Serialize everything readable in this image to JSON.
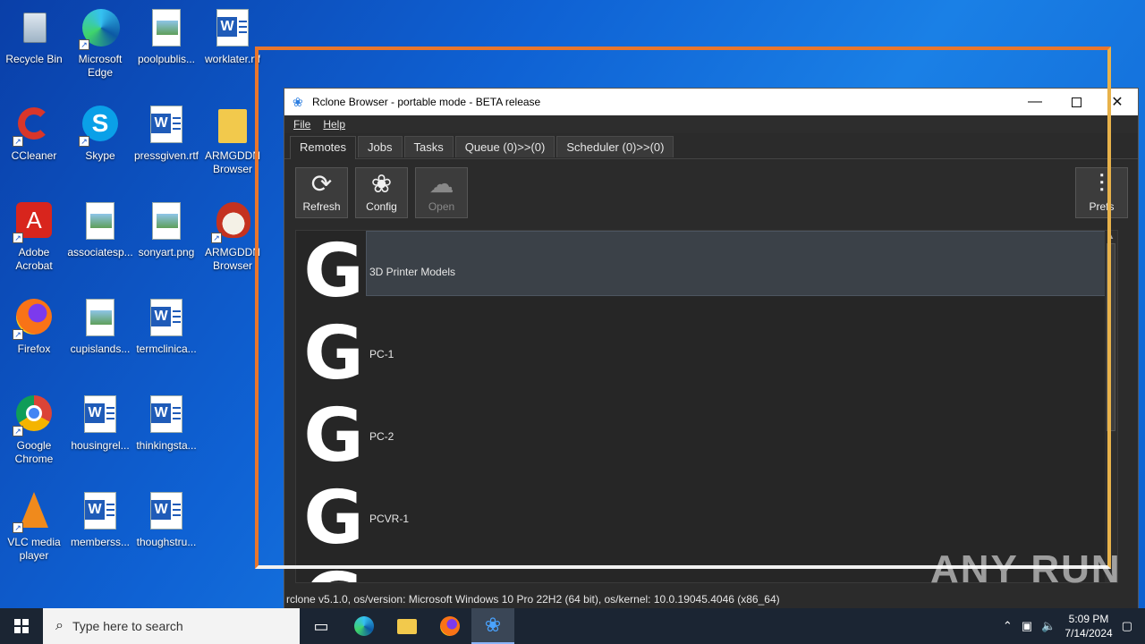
{
  "desktop_icons": [
    {
      "label": "Recycle Bin"
    },
    {
      "label": "Microsoft Edge"
    },
    {
      "label": "poolpublis..."
    },
    {
      "label": "worklater.rtf"
    },
    {
      "label": "CCleaner"
    },
    {
      "label": "Skype"
    },
    {
      "label": "pressgiven.rtf"
    },
    {
      "label": "ARMGDDN Browser"
    },
    {
      "label": "Adobe Acrobat"
    },
    {
      "label": "associatesp..."
    },
    {
      "label": "sonyart.png"
    },
    {
      "label": "ARMGDDN Browser"
    },
    {
      "label": "Firefox"
    },
    {
      "label": "cupislands..."
    },
    {
      "label": "termclinica..."
    },
    {
      "label": "Google Chrome"
    },
    {
      "label": "housingrel..."
    },
    {
      "label": "thinkingsta..."
    },
    {
      "label": "VLC media player"
    },
    {
      "label": "memberss..."
    },
    {
      "label": "thoughstru..."
    }
  ],
  "window": {
    "title": "Rclone Browser - portable mode - BETA release",
    "menu": {
      "file": "File",
      "help": "Help"
    },
    "tabs": [
      {
        "label": "Remotes"
      },
      {
        "label": "Jobs"
      },
      {
        "label": "Tasks"
      },
      {
        "label": "Queue (0)>>(0)"
      },
      {
        "label": "Scheduler (0)>>(0)"
      }
    ],
    "toolbar": {
      "refresh": "Refresh",
      "config": "Config",
      "open": "Open",
      "prefs": "Prefs"
    },
    "remotes": [
      {
        "name": "3D Printer Models"
      },
      {
        "name": "PC-1"
      },
      {
        "name": "PC-2"
      },
      {
        "name": "PCVR-1"
      }
    ],
    "status": "rclone v5.1.0, os/version: Microsoft Windows 10 Pro 22H2 (64 bit), os/kernel: 10.0.19045.4046 (x86_64)"
  },
  "watermark": "ANY RUN",
  "taskbar": {
    "search_placeholder": "Type here to search",
    "time": "5:09 PM",
    "date": "7/14/2024"
  },
  "colors": {
    "frame_orange": "#e8762d",
    "window_bg": "#2b2b2b",
    "taskbar_bg": "#1b2533"
  }
}
